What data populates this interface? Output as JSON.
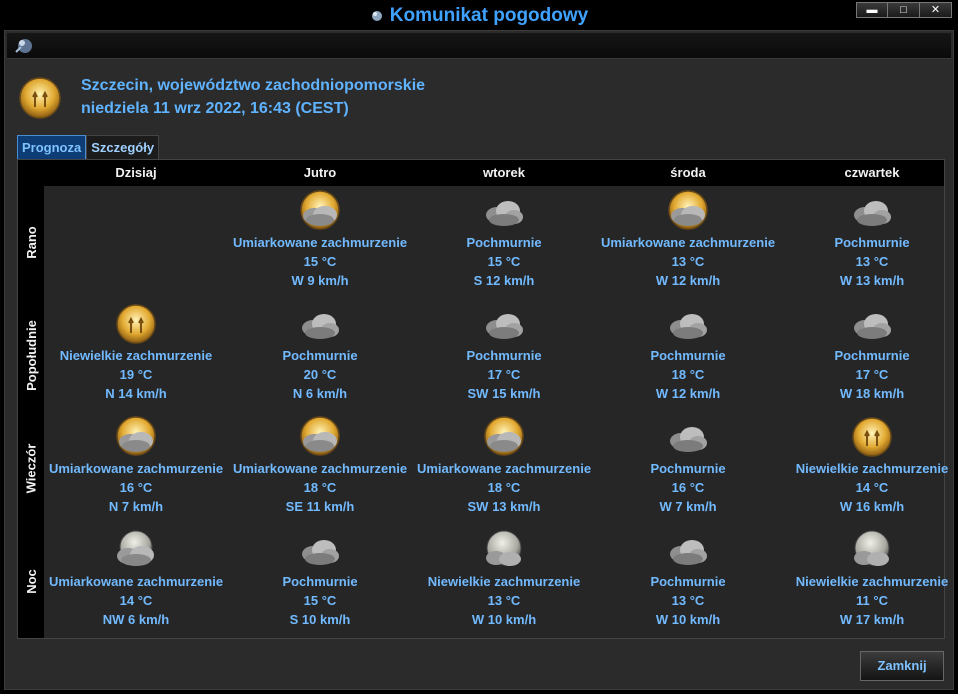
{
  "window": {
    "title": "Komunikat pogodowy",
    "controls": {
      "minimize": "▬",
      "maximize": "□",
      "close": "✕"
    }
  },
  "header": {
    "location": "Szczecin, województwo zachodniopomorskie",
    "datetime": "niedziela 11 wrz 2022, 16:43 (CEST)",
    "current_icon": "sun-cloud-icon"
  },
  "tabs": [
    {
      "label": "Prognoza",
      "active": true
    },
    {
      "label": "Szczegóły",
      "active": false
    }
  ],
  "forecast": {
    "days": [
      "Dzisiaj",
      "Jutro",
      "wtorek",
      "środa",
      "czwartek"
    ],
    "periods": [
      "Rano",
      "Popołudnie",
      "Wieczór",
      "Noc"
    ],
    "cells": [
      [
        null,
        {
          "icon": "sun-cloud-icon",
          "condition": "Umiarkowane zachmurzenie",
          "temp": "15 °C",
          "wind": "W 9 km/h"
        },
        {
          "icon": "cloud-icon",
          "condition": "Pochmurnie",
          "temp": "15 °C",
          "wind": "S 12 km/h"
        },
        {
          "icon": "sun-cloud-icon",
          "condition": "Umiarkowane zachmurzenie",
          "temp": "13 °C",
          "wind": "W 12 km/h"
        },
        {
          "icon": "cloud-icon",
          "condition": "Pochmurnie",
          "temp": "13 °C",
          "wind": "W 13 km/h"
        }
      ],
      [
        {
          "icon": "sun-icon",
          "condition": "Niewielkie zachmurzenie",
          "temp": "19 °C",
          "wind": "N 14 km/h"
        },
        {
          "icon": "cloud-icon",
          "condition": "Pochmurnie",
          "temp": "20 °C",
          "wind": "N 6 km/h"
        },
        {
          "icon": "cloud-icon",
          "condition": "Pochmurnie",
          "temp": "17 °C",
          "wind": "SW 15 km/h"
        },
        {
          "icon": "cloud-icon",
          "condition": "Pochmurnie",
          "temp": "18 °C",
          "wind": "W 12 km/h"
        },
        {
          "icon": "cloud-icon",
          "condition": "Pochmurnie",
          "temp": "17 °C",
          "wind": "W 18 km/h"
        }
      ],
      [
        {
          "icon": "sun-cloud-icon",
          "condition": "Umiarkowane zachmurzenie",
          "temp": "16 °C",
          "wind": "N 7 km/h"
        },
        {
          "icon": "sun-cloud-icon",
          "condition": "Umiarkowane zachmurzenie",
          "temp": "18 °C",
          "wind": "SE 11 km/h"
        },
        {
          "icon": "sun-cloud-icon",
          "condition": "Umiarkowane zachmurzenie",
          "temp": "18 °C",
          "wind": "SW 13 km/h"
        },
        {
          "icon": "cloud-icon",
          "condition": "Pochmurnie",
          "temp": "16 °C",
          "wind": "W 7 km/h"
        },
        {
          "icon": "sun-icon",
          "condition": "Niewielkie zachmurzenie",
          "temp": "14 °C",
          "wind": "W 16 km/h"
        }
      ],
      [
        {
          "icon": "moon-cloud-icon",
          "condition": "Umiarkowane zachmurzenie",
          "temp": "14 °C",
          "wind": "NW 6 km/h"
        },
        {
          "icon": "cloud-icon",
          "condition": "Pochmurnie",
          "temp": "15 °C",
          "wind": "S 10 km/h"
        },
        {
          "icon": "moon-icon",
          "condition": "Niewielkie zachmurzenie",
          "temp": "13 °C",
          "wind": "W 10 km/h"
        },
        {
          "icon": "cloud-icon",
          "condition": "Pochmurnie",
          "temp": "13 °C",
          "wind": "W 10 km/h"
        },
        {
          "icon": "moon-icon",
          "condition": "Niewielkie zachmurzenie",
          "temp": "11 °C",
          "wind": "W 17 km/h"
        }
      ]
    ]
  },
  "buttons": {
    "close": "Zamknij"
  },
  "colors": {
    "accent": "#5fb3ff",
    "text_blue": "#72baff",
    "panel_bg": "#262626",
    "tab_active": "#0d3d74"
  }
}
